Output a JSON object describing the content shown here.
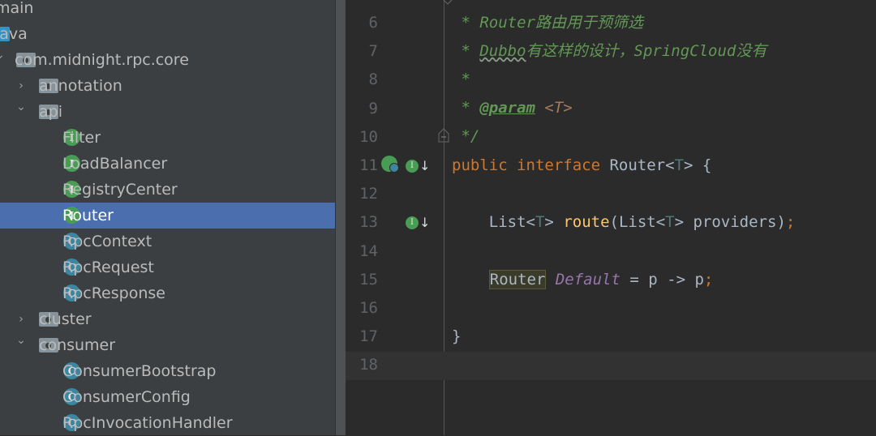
{
  "project_tree": [
    {
      "label": "main",
      "level": 0,
      "icon": "none",
      "chevron": "none"
    },
    {
      "label": "java",
      "level": 0,
      "icon": "source-folder-icon",
      "chevron": "none"
    },
    {
      "label": "com.midnight.rpc.core",
      "level": 1,
      "icon": "package-icon",
      "chevron": "expanded"
    },
    {
      "label": "annotation",
      "level": 2,
      "icon": "package-icon",
      "chevron": "collapsed"
    },
    {
      "label": "api",
      "level": 2,
      "icon": "package-icon",
      "chevron": "expanded"
    },
    {
      "label": "Filter",
      "level": 3,
      "icon": "interface-icon",
      "kind": "I"
    },
    {
      "label": "LoadBalancer",
      "level": 3,
      "icon": "interface-icon",
      "kind": "I"
    },
    {
      "label": "RegistryCenter",
      "level": 3,
      "icon": "interface-icon",
      "kind": "I"
    },
    {
      "label": "Router",
      "level": 3,
      "icon": "interface-icon",
      "kind": "I",
      "selected": true
    },
    {
      "label": "RpcContext",
      "level": 3,
      "icon": "class-icon",
      "kind": "C"
    },
    {
      "label": "RpcRequest",
      "level": 3,
      "icon": "class-icon",
      "kind": "C"
    },
    {
      "label": "RpcResponse",
      "level": 3,
      "icon": "class-icon",
      "kind": "C"
    },
    {
      "label": "cluster",
      "level": 2,
      "icon": "package-icon",
      "chevron": "collapsed"
    },
    {
      "label": "consumer",
      "level": 2,
      "icon": "package-icon",
      "chevron": "expanded"
    },
    {
      "label": "ConsumerBootstrap",
      "level": 3,
      "icon": "class-icon",
      "kind": "C"
    },
    {
      "label": "ConsumerConfig",
      "level": 3,
      "icon": "class-icon",
      "kind": "C"
    },
    {
      "label": "RpcInvocationHandler",
      "level": 3,
      "icon": "class-icon",
      "kind": "C"
    }
  ],
  "editor": {
    "line_numbers": [
      "6",
      "7",
      "8",
      "9",
      "10",
      "11",
      "12",
      "13",
      "14",
      "15",
      "16",
      "17",
      "18"
    ],
    "lines": {
      "l6": {
        "star": " * ",
        "text": "Router路由用于预筛选"
      },
      "l7": {
        "star": " * ",
        "dubbo": "Dubbo",
        "text": "有这样的设计，SpringCloud没有"
      },
      "l8": {
        "star": " *"
      },
      "l9": {
        "star": " * ",
        "tag": "@param",
        "param": " <T>"
      },
      "l10": {
        "end": " */"
      },
      "l11": {
        "kw1": "public ",
        "kw2": "interface ",
        "name": "Router",
        "lt": "<",
        "tp": "T",
        "gt": "> {"
      },
      "l13": {
        "indent": "    ",
        "a": "List<",
        "tp1": "T",
        "b": "> ",
        "fn": "route",
        "c": "(List<",
        "tp2": "T",
        "d": "> providers)",
        "semi": ";"
      },
      "l15": {
        "indent": "    ",
        "type": "Router",
        "sp": " ",
        "df": "Default",
        "rest": " = p -> p",
        "semi": ";"
      },
      "l17": {
        "brace": "}"
      }
    },
    "current_line": "18"
  }
}
